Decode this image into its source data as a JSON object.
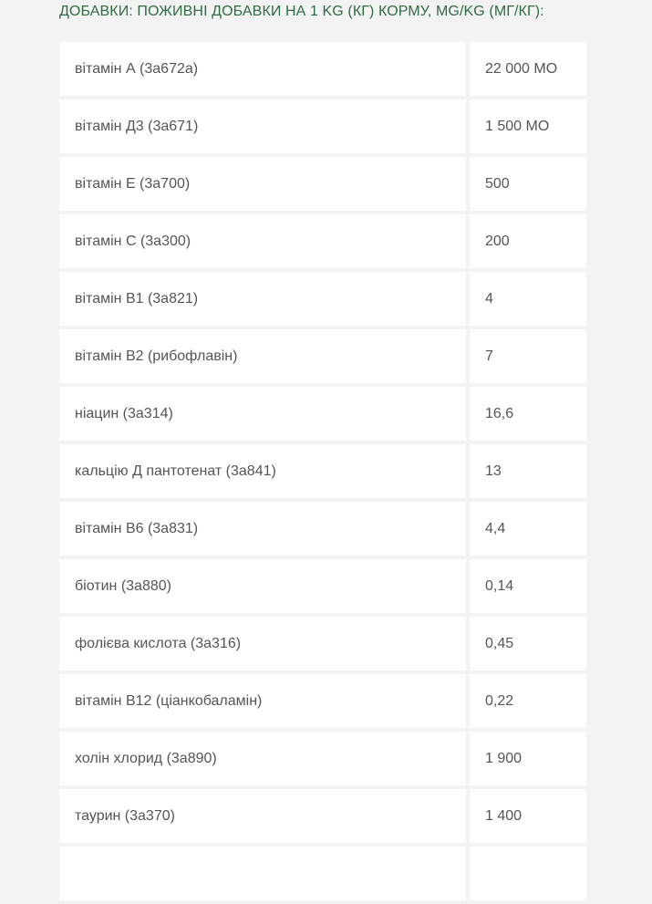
{
  "heading": "ДОБАВКИ: ПОЖИВНІ ДОБАВКИ НА 1 KG (КГ) КОРМУ, MG/KG (МГ/КГ):",
  "rows": [
    {
      "name": "вітамін А (3а672а)",
      "value": "22 000 МО"
    },
    {
      "name": "вітамін Д3 (3а671)",
      "value": "1 500 МО"
    },
    {
      "name": "вітамін Е (3а700)",
      "value": "500"
    },
    {
      "name": "вітамін С (3а300)",
      "value": "200"
    },
    {
      "name": "вітамін В1 (3а821)",
      "value": "4"
    },
    {
      "name": "вітамін В2 (рибофлавін)",
      "value": "7"
    },
    {
      "name": "ніацин (3а314)",
      "value": "16,6"
    },
    {
      "name": "кальцію Д пантотенат (3а841)",
      "value": "13"
    },
    {
      "name": "вітамін В6 (3а831)",
      "value": "4,4"
    },
    {
      "name": "біотин (3а880)",
      "value": "0,14"
    },
    {
      "name": "фолієва кислота (3а316)",
      "value": "0,45"
    },
    {
      "name": "вітамін В12 (ціанкобаламін)",
      "value": "0,22"
    },
    {
      "name": "холін хлорид (3а890)",
      "value": "1 900"
    },
    {
      "name": "таурин (3а370)",
      "value": "1 400"
    },
    {
      "name": "",
      "value": ""
    }
  ]
}
